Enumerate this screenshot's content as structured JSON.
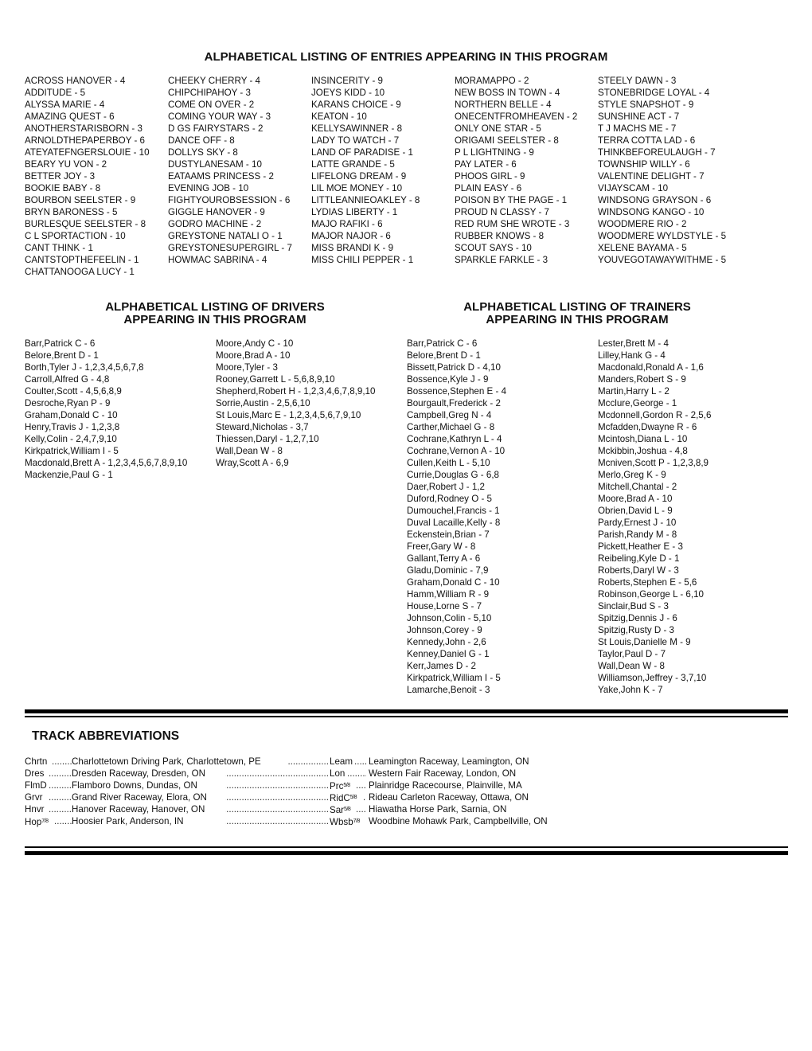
{
  "entries": {
    "title": "ALPHABETICAL LISTING OF ENTRIES APPEARING IN THIS PROGRAM",
    "columns": [
      [
        "ACROSS HANOVER - 4",
        "ADDITUDE - 5",
        "ALYSSA MARIE - 4",
        "AMAZING QUEST - 6",
        "ANOTHERSTARISBORN - 3",
        "ARNOLDTHEPAPERBOY - 6",
        "ATEYATEFNGERSLOUIE - 10",
        "BEARY YU VON - 2",
        "BETTER JOY - 3",
        "BOOKIE BABY - 8",
        "BOURBON SEELSTER - 9",
        "BRYN BARONESS - 5",
        "BURLESQUE SEELSTER - 8",
        "C L SPORTACTION - 10",
        "CANT THINK - 1",
        "CANTSTOPTHEFEELIN - 1",
        "CHATTANOOGA LUCY - 1"
      ],
      [
        "CHEEKY CHERRY - 4",
        "CHIPCHIPAHOY - 3",
        "COME ON OVER - 2",
        "COMING YOUR WAY - 3",
        "D GS FAIRYSTARS - 2",
        "DANCE OFF - 8",
        "DOLLYS SKY - 8",
        "DUSTYLANESAM - 10",
        "EATAAMS PRINCESS - 2",
        "EVENING JOB - 10",
        "FIGHTYOUROBSESSION - 6",
        "GIGGLE HANOVER - 9",
        "GODRO MACHINE - 2",
        "GREYSTONE NATALI O - 1",
        "GREYSTONESUPERGIRL - 7",
        "HOWMAC SABRINA - 4"
      ],
      [
        "INSINCERITY - 9",
        "JOEYS KIDD - 10",
        "KARANS CHOICE - 9",
        "KEATON - 10",
        "KELLYSAWINNER - 8",
        "LADY TO WATCH - 7",
        "LAND OF PARADISE - 1",
        "LATTE GRANDE - 5",
        "LIFELONG DREAM - 9",
        "LIL MOE MONEY - 10",
        "LITTLEANNIEOAKLEY - 8",
        "LYDIAS LIBERTY - 1",
        "MAJO RAFIKI - 6",
        "MAJOR NAJOR - 6",
        "MISS BRANDI K - 9",
        "MISS CHILI PEPPER - 1"
      ],
      [
        "MORAMAPPO - 2",
        "NEW BOSS IN TOWN - 4",
        "NORTHERN BELLE - 4",
        "ONECENTFROMHEAVEN - 2",
        "ONLY ONE STAR - 5",
        "ORIGAMI SEELSTER - 8",
        "P L LIGHTNING - 9",
        "PAY LATER - 6",
        "PHOOS GIRL - 9",
        "PLAIN EASY - 6",
        "POISON BY THE PAGE - 1",
        "PROUD N CLASSY - 7",
        "RED RUM SHE WROTE - 3",
        "RUBBER KNOWS - 8",
        "SCOUT SAYS - 10",
        "SPARKLE FARKLE - 3"
      ],
      [
        "STEELY DAWN - 3",
        "STONEBRIDGE LOYAL - 4",
        "STYLE SNAPSHOT - 9",
        "SUNSHINE ACT - 7",
        "T J MACHS ME - 7",
        "TERRA COTTA LAD - 6",
        "THINKBEFOREULAUGH - 7",
        "TOWNSHIP WILLY - 6",
        "VALENTINE DELIGHT - 7",
        "VIJAYSCAM - 10",
        "WINDSONG GRAYSON - 6",
        "WINDSONG KANGO - 10",
        "WOODMERE RIO - 2",
        "WOODMERE WYLDSTYLE - 5",
        "XELENE BAYAMA - 5",
        "YOUVEGOTAWAYWITHME - 5"
      ]
    ]
  },
  "drivers": {
    "title_line1": "ALPHABETICAL LISTING OF DRIVERS",
    "title_line2": "APPEARING IN THIS PROGRAM",
    "columns": [
      [
        "Barr,Patrick C - 6",
        "Belore,Brent D - 1",
        "Borth,Tyler J - 1,2,3,4,5,6,7,8",
        "Carroll,Alfred G - 4,8",
        "Coulter,Scott - 4,5,6,8,9",
        "Desroche,Ryan P - 9",
        "Graham,Donald C - 10",
        "Henry,Travis J - 1,2,3,8",
        "Kelly,Colin - 2,4,7,9,10",
        "Kirkpatrick,William I - 5",
        "Macdonald,Brett A - 1,2,3,4,5,6,7,8,9,10",
        "Mackenzie,Paul G - 1"
      ],
      [
        "Moore,Andy C - 10",
        "Moore,Brad A - 10",
        "Moore,Tyler - 3",
        "Rooney,Garrett L - 5,6,8,9,10",
        "Shepherd,Robert H - 1,2,3,4,6,7,8,9,10",
        "Sorrie,Austin - 2,5,6,10",
        "St Louis,Marc E - 1,2,3,4,5,6,7,9,10",
        "Steward,Nicholas - 3,7",
        "Thiessen,Daryl - 1,2,7,10",
        "Wall,Dean W - 8",
        "Wray,Scott A - 6,9"
      ]
    ]
  },
  "trainers": {
    "title_line1": "ALPHABETICAL LISTING OF TRAINERS",
    "title_line2": "APPEARING IN THIS PROGRAM",
    "columns": [
      [
        "Barr,Patrick C - 6",
        "Belore,Brent D - 1",
        "Bissett,Patrick D - 4,10",
        "Bossence,Kyle J - 9",
        "Bossence,Stephen E - 4",
        "Bourgault,Frederick - 2",
        "Campbell,Greg N - 4",
        "Carther,Michael G - 8",
        "Cochrane,Kathryn L - 4",
        "Cochrane,Vernon A - 10",
        "Cullen,Keith L - 5,10",
        "Currie,Douglas G - 6,8",
        "Daer,Robert J - 1,2",
        "Duford,Rodney O - 5",
        "Dumouchel,Francis - 1",
        "Duval Lacaille,Kelly - 8",
        "Eckenstein,Brian - 7",
        "Freer,Gary W - 8",
        "Gallant,Terry A - 6",
        "Gladu,Dominic - 7,9",
        "Graham,Donald C - 10",
        "Hamm,William R - 9",
        "House,Lorne S - 7",
        "Johnson,Colin - 5,10",
        "Johnson,Corey - 9",
        "Kennedy,John - 2,6",
        "Kenney,Daniel G - 1",
        "Kerr,James D - 2",
        "Kirkpatrick,William I - 5",
        "Lamarche,Benoit - 3"
      ],
      [
        "Lester,Brett M - 4",
        "Lilley,Hank G - 4",
        "Macdonald,Ronald A - 1,6",
        "Manders,Robert S - 9",
        "Martin,Harry L - 2",
        "Mcclure,George - 1",
        "Mcdonnell,Gordon R - 2,5,6",
        "Mcfadden,Dwayne R - 6",
        "Mcintosh,Diana L - 10",
        "Mckibbin,Joshua - 4,8",
        "Mcniven,Scott P - 1,2,3,8,9",
        "Merlo,Greg K - 9",
        "Mitchell,Chantal - 2",
        "Moore,Brad A - 10",
        "Obrien,David L - 9",
        "Pardy,Ernest J - 10",
        "Parish,Randy M - 8",
        "Pickett,Heather E - 3",
        "Reibeling,Kyle D - 1",
        "Roberts,Daryl W - 3",
        "Roberts,Stephen E - 5,6",
        "Robinson,George L - 6,10",
        "Sinclair,Bud S - 3",
        "Spitzig,Dennis J - 6",
        "Spitzig,Rusty D - 3",
        "St Louis,Danielle M - 9",
        "Taylor,Paul D - 7",
        "Wall,Dean W - 8",
        "Williamson,Jeffrey - 3,7,10",
        "Yake,John K - 7"
      ]
    ]
  },
  "tracks": {
    "title": "TRACK ABBREVIATIONS",
    "rows": [
      {
        "left_code": "Chrtn",
        "left_frac": "",
        "left_name": "Charlottetown Driving Park, Charlottetown, PE",
        "right_code": "Leam",
        "right_frac": "",
        "right_name": "Leamington Raceway, Leamington, ON"
      },
      {
        "left_code": "Dres",
        "left_frac": "",
        "left_name": "Dresden Raceway, Dresden, ON",
        "right_code": "Lon",
        "right_frac": "",
        "right_name": "Western Fair Raceway, London, ON"
      },
      {
        "left_code": "FlmD",
        "left_frac": "",
        "left_name": "Flamboro Downs, Dundas, ON",
        "right_code": "Prc",
        "right_frac": "5/8",
        "right_name": "Plainridge Racecourse, Plainville, MA"
      },
      {
        "left_code": "Grvr",
        "left_frac": "",
        "left_name": "Grand River Raceway, Elora, ON",
        "right_code": "RidC",
        "right_frac": "5/8",
        "right_name": "Rideau Carleton Raceway, Ottawa, ON"
      },
      {
        "left_code": "Hnvr",
        "left_frac": "",
        "left_name": "Hanover Raceway, Hanover, ON",
        "right_code": "Sar",
        "right_frac": "5/8",
        "right_name": "Hiawatha Horse Park, Sarnia, ON"
      },
      {
        "left_code": "Hop",
        "left_frac": "7/8",
        "left_name": "Hoosier Park, Anderson, IN",
        "right_code": "Wbsb",
        "right_frac": "7/8",
        "right_name": "Woodbine Mohawk Park, Campbellville, ON"
      }
    ]
  }
}
